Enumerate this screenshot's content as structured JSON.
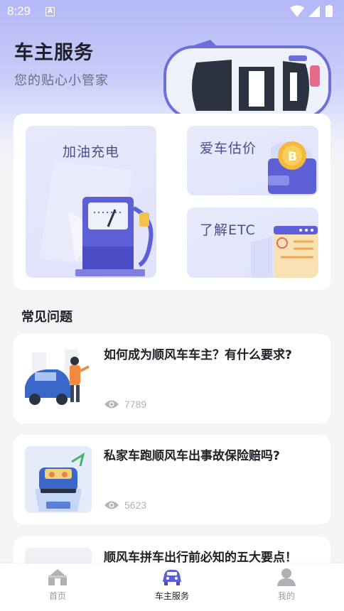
{
  "status_bar": {
    "time": "8:29",
    "notification_glyph": "A"
  },
  "header": {
    "title": "车主服务",
    "subtitle": "您的贴心小管家"
  },
  "services": [
    {
      "label": "加油充电",
      "icon": "fuel-pump-icon"
    },
    {
      "label": "爱车估价",
      "icon": "wallet-coin-icon"
    },
    {
      "label": "了解ETC",
      "icon": "document-icon"
    }
  ],
  "faq": {
    "section_title": "常见问题",
    "items": [
      {
        "title": "如何成为顺风车车主？有什么要求?",
        "views": "7789"
      },
      {
        "title": "私家车跑顺风车出事故保险赔吗?",
        "views": "5623"
      },
      {
        "title": "顺风车拼车出行前必知的五大要点！",
        "views": ""
      }
    ]
  },
  "bottom_nav": {
    "items": [
      {
        "label": "首页",
        "icon": "home-icon",
        "active": false
      },
      {
        "label": "车主服务",
        "icon": "car-icon",
        "active": true
      },
      {
        "label": "我的",
        "icon": "profile-icon",
        "active": false
      }
    ]
  },
  "colors": {
    "accent": "#5a5fd6",
    "header_gradient": "#b3b8f7",
    "background": "#f5f5f7"
  }
}
